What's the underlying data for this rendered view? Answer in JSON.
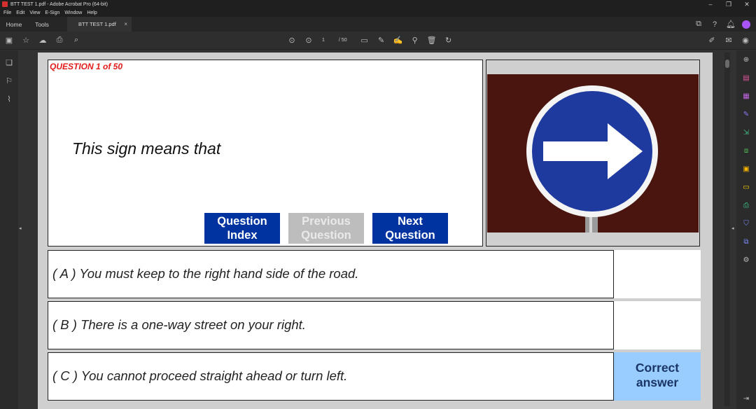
{
  "window": {
    "title": "BTT TEST 1.pdf - Adobe Acrobat Pro (64-bit)"
  },
  "menu": [
    "File",
    "Edit",
    "View",
    "E-Sign",
    "Window",
    "Help"
  ],
  "tabs": {
    "home": "Home",
    "tools": "Tools",
    "document": "BTT TEST 1.pdf"
  },
  "toolbar": {
    "current_page": "1",
    "page_total": "/ 50"
  },
  "quiz": {
    "question_number": "QUESTION 1 of 50",
    "question_text": "This sign means that",
    "buttons": {
      "index": "Question Index",
      "previous": "Previous Question",
      "next": "Next Question"
    },
    "answers": [
      {
        "label": "( A )",
        "text": "You must keep to the right hand side of the road.",
        "mark": ""
      },
      {
        "label": "( B )",
        "text": "There is a one-way street on your right.",
        "mark": ""
      },
      {
        "label": "( C )",
        "text": "You cannot proceed straight ahead or turn left.",
        "mark": "Correct answer"
      }
    ]
  },
  "colors": {
    "accent_blue": "#0033a0",
    "question_red": "#e21b1b",
    "correct_fill": "#99ccff",
    "sign_background": "#4a150e"
  }
}
